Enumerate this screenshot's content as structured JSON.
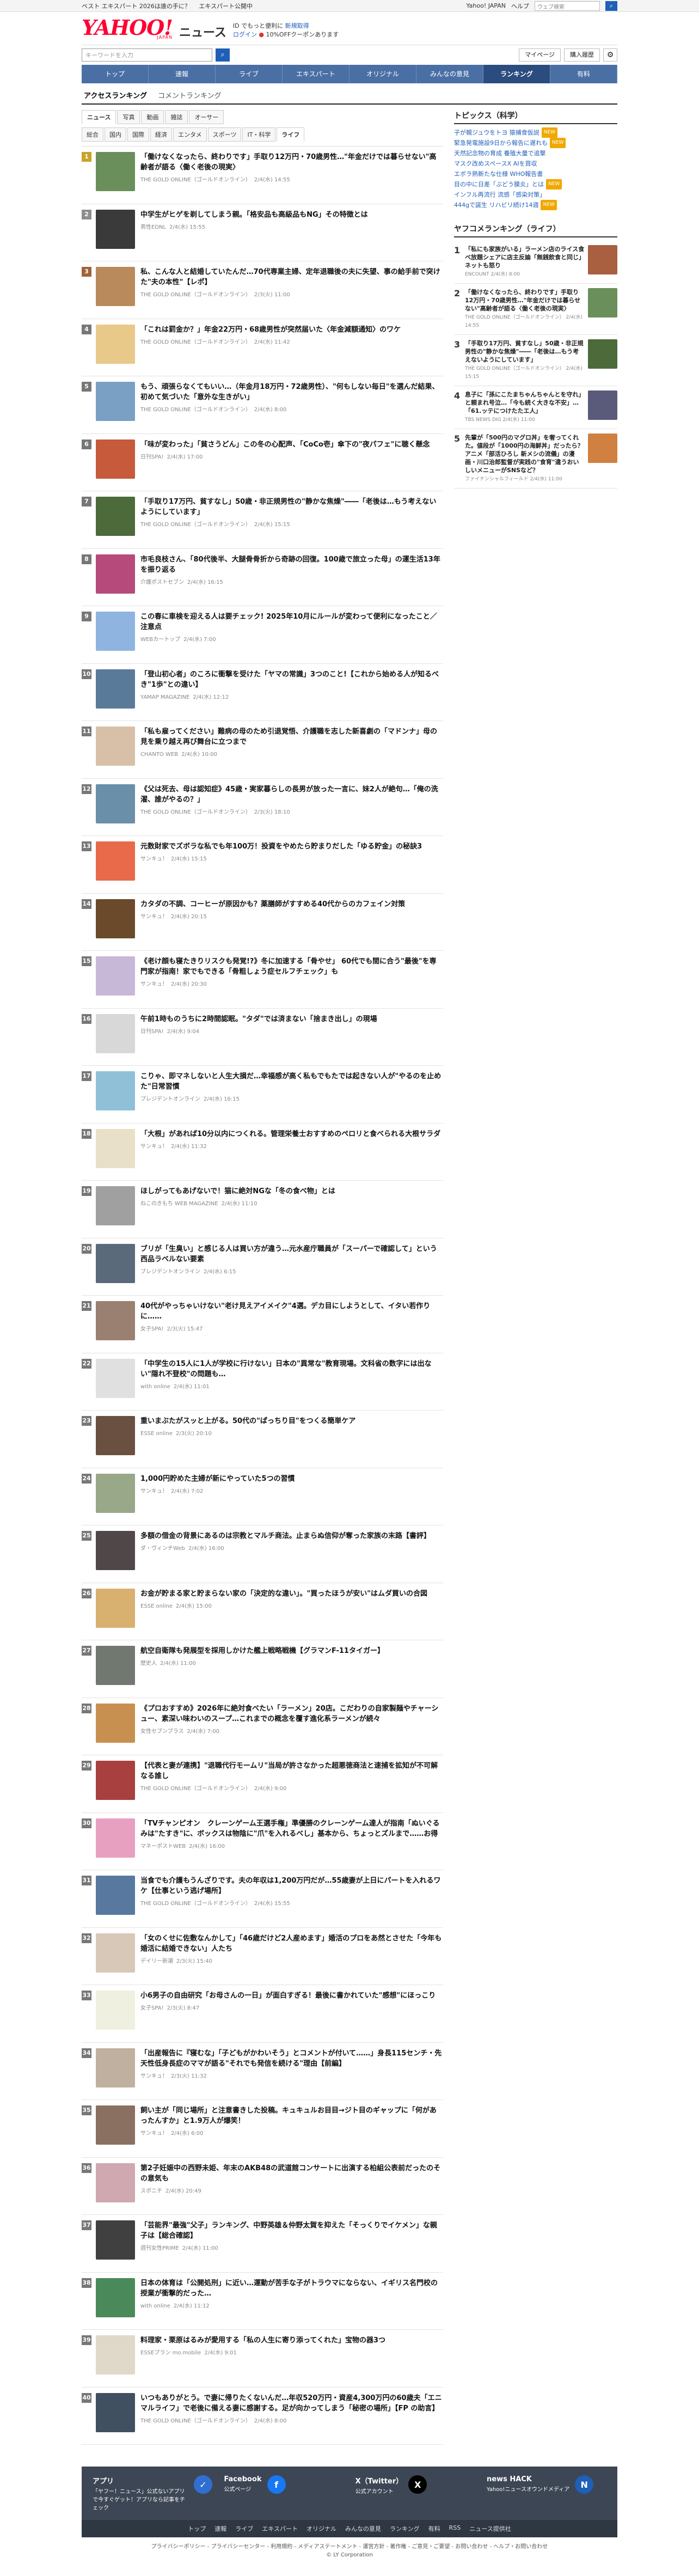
{
  "promo_bar": {
    "left1": "ベスト エキスパート 2026は誰の手に？",
    "left2": "エキスパート公開中",
    "right_links": [
      "Yahoo! JAPAN",
      "ヘルプ"
    ],
    "search_placeholder": "ウェブ検索"
  },
  "masthead": {
    "logo": "YAHOO!",
    "logo_sub": "JAPAN",
    "service": "ニュース",
    "info1_a": "ID でもっと便利に",
    "info1_b": "新規取得",
    "info2_a": "ログイン",
    "info2_b": "10%OFFクーポンあります"
  },
  "search": {
    "placeholder": "キーワードを入力",
    "mypage": "マイページ",
    "subscribe": "購入履歴"
  },
  "gnav": [
    "トップ",
    "速報",
    "ライブ",
    "エキスパート",
    "オリジナル",
    "みんなの意見",
    "ランキング",
    "有料"
  ],
  "gnav_active": 6,
  "subnav": [
    "アクセスランキング",
    "コメントランキング"
  ],
  "media_tabs": [
    "ニュース",
    "写真",
    "動画",
    "雑誌",
    "オーサー"
  ],
  "category_tabs": [
    "総合",
    "国内",
    "国際",
    "経済",
    "エンタメ",
    "スポーツ",
    "IT・科学",
    "ライフ"
  ],
  "rankings": [
    {
      "rank": "1",
      "title": "「働けなくなったら、終わりです」手取り12万円・70歳男性…\"年金だけでは暮らせない\"高齢者が語る〈働く老後の現実〉",
      "source": "THE GOLD ONLINE（ゴールドオンライン）",
      "time": "2/4(水) 14:55",
      "thumb": "#6b8f5a"
    },
    {
      "rank": "2",
      "title": "中学生がヒゲを剃してしまう親。「格安品も高級品もNG」その特徴とは",
      "source": "男性EDNL",
      "time": "2/4(水) 15:55",
      "thumb": "#3a3a3a"
    },
    {
      "rank": "3",
      "title": "私、こんな人と結婚していたんだ…70代専業主婦、定年退職後の夫に失望、事の給手前で突けた\"夫の本性\"【レポ】",
      "source": "THE GOLD ONLINE（ゴールドオンライン）",
      "time": "2/3(火) 11:00",
      "thumb": "#b88a5c"
    },
    {
      "rank": "4",
      "title": "「これは罰金か？」年金22万円・68歳男性が突然届いた〈年金減額通知〉のワケ",
      "source": "THE GOLD ONLINE（ゴールドオンライン）",
      "time": "2/4(水) 11:42",
      "thumb": "#e8c98a"
    },
    {
      "rank": "5",
      "title": "もう、頑張らなくてもいい…（年金月18万円・72歳男性）、\"何もしない毎日\"を選んだ結果、初めて気づいた「意外な生きがい」",
      "source": "THE GOLD ONLINE（ゴールドオンライン）",
      "time": "2/4(水) 8:00",
      "thumb": "#7aa0c4"
    },
    {
      "rank": "6",
      "title": "「味が変わった」「貧さうどん」この冬の心配声、「CoCo壱」傘下の\"夜パフェ\"に聴く懸念",
      "source": "日刊SPA!",
      "time": "2/4(水) 17:00",
      "thumb": "#c65a3a"
    },
    {
      "rank": "7",
      "title": "「手取り17万円、貧すなし」50歳・非正規男性の\"静かな焦燥\"――「老後は…もう考えないようにしています」",
      "source": "THE GOLD ONLINE（ゴールドオンライン）",
      "time": "2/4(水) 15:15",
      "thumb": "#4d6a3a"
    },
    {
      "rank": "8",
      "title": "市毛良枝さん、「80代後半、大腿骨骨折から奇跡の回復。100歳で旅立った母」の運生活13年を振り返る",
      "source": "介護ポストセブン",
      "time": "2/4(水) 16:15",
      "thumb": "#b64a7a"
    },
    {
      "rank": "9",
      "title": "この春に車検を迎える人は要チェック! 2025年10月にルールが変わって便利になったこと／注意点",
      "source": "WEBカートップ",
      "time": "2/4(水) 7:00",
      "thumb": "#8fb4e0"
    },
    {
      "rank": "10",
      "title": "「登山初心者」のころに衝撃を受けた「ヤマの常識」3つのこと!【これから始める人が知るべき\"1歩\"との違い】",
      "source": "YAMAP MAGAZINE",
      "time": "2/4(水) 12:12",
      "thumb": "#5a7a9a"
    },
    {
      "rank": "11",
      "title": "「私も雇ってください」難病の母のため引退覚悟、介護職を志した新喜劇の「マドンナ」母の見を乗り越え再び舞台に立つまで",
      "source": "CHANTO WEB",
      "time": "2/4(水) 10:00",
      "thumb": "#d8c0a8"
    },
    {
      "rank": "12",
      "title": "《父は死去、母は認知症》45歳・実家暮らしの長男が放った一言に、妹2人が絶句…「俺の洗濯、誰がやるの？」",
      "source": "THE GOLD ONLINE（ゴールドオンライン）",
      "time": "2/3(火) 18:10",
      "thumb": "#6a8fa8"
    },
    {
      "rank": "13",
      "title": "元数財家でズボラな私でも年100万！投資をやめたら貯まりだした「ゆる貯金」の秘訣3",
      "source": "サンキュ！",
      "time": "2/4(水) 15:15",
      "thumb": "#e86a4a"
    },
    {
      "rank": "14",
      "title": "カタダの不調、コーヒーが原因かも？薬膳師がすすめる40代からのカフェイン対策",
      "source": "サンキュ！",
      "time": "2/4(水) 20:15",
      "thumb": "#6a4a2a"
    },
    {
      "rank": "15",
      "title": "《老け顔も寝たきりリスクも発覚!?》冬に加速する「骨やせ」 60代でも間に合う\"最後\"を専門家が指南！家でもできる「骨粗しょう症セルフチェック」も",
      "source": "サンキュ！",
      "time": "2/4(水) 20:30",
      "thumb": "#c8b8d8"
    },
    {
      "rank": "16",
      "title": "午前1時ものうちに2時間認眠。\"タダ\"では済まない「捨まき出し」の現場",
      "source": "日刊SPA!",
      "time": "2/4(水) 9:04",
      "thumb": "#d8d8d8"
    },
    {
      "rank": "17",
      "title": "こりゃ、即マネしないと人生大損だ…幸福感が高く私もでもたでは起きない人が\"やるのを止めた\"日常習慣",
      "source": "プレジデントオンライン",
      "time": "2/4(水) 16:15",
      "thumb": "#8fc0d8"
    },
    {
      "rank": "18",
      "title": "「大根」があれば10分以内につくれる。管理栄養士おすすめのペロリと食べられる大根サラダ",
      "source": "サンキュ！",
      "time": "2/4(水) 11:32",
      "thumb": "#e8e0c8"
    },
    {
      "rank": "19",
      "title": "ほしがってもあげないで！猫に絶対NGな「冬の食べ物」とは",
      "source": "ねこのきもち WEB MAGAZINE",
      "time": "2/4(水) 11:10",
      "thumb": "#a0a0a0"
    },
    {
      "rank": "20",
      "title": "ブリが「生臭い」と感じる人は買い方が違う…元水産庁職員が「スーパーで確認して」という西品ラベルない要素",
      "source": "プレジデントオンライン",
      "time": "2/4(水) 6:15",
      "thumb": "#5a6a7a"
    },
    {
      "rank": "21",
      "title": "40代がやっちゃいけない\"老け見えアイメイク\"4選。デカ目にしようとして、イタい若作りに……",
      "source": "女子SPA!",
      "time": "2/3(火) 15:47",
      "thumb": "#9a8070"
    },
    {
      "rank": "22",
      "title": "「中学生の15人に1人が学校に行けない」日本の\"異常な\"教育現場。文科省の数字には出ない\"隠れ不登校\"の問題も…",
      "source": "with online",
      "time": "2/4(水) 11:01",
      "thumb": "#e0e0e0"
    },
    {
      "rank": "23",
      "title": "重いまぶたがスッと上がる。50代の\"ぱっちり目\"をつくる簡単ケア",
      "source": "ESSE online",
      "time": "2/3(火) 20:10",
      "thumb": "#6a5040"
    },
    {
      "rank": "24",
      "title": "1,000円貯めた主婦が新にやっていた5つの習慣",
      "source": "サンキュ！",
      "time": "2/4(水) 7:02",
      "thumb": "#98a888"
    },
    {
      "rank": "25",
      "title": "多額の借金の背景にあるのは宗教とマルチ商法。止まらぬ信仰が奪った家族の末路【書評】",
      "source": "ダ・ヴィンチWeb",
      "time": "2/4(水) 16:00",
      "thumb": "#504848"
    },
    {
      "rank": "26",
      "title": "お金が貯まる家と貯まらない家の「決定的な違い」。\"買ったほうが安い\"はムダ買いの合図",
      "source": "ESSE online",
      "time": "2/4(水) 15:00",
      "thumb": "#d8b070"
    },
    {
      "rank": "27",
      "title": "航空自衛隊も発展型を採用しかけた艦上戦略戦機【グラマンF-11タイガー】",
      "source": "歴史人",
      "time": "2/4(水) 11:00",
      "thumb": "#707870"
    },
    {
      "rank": "28",
      "title": "《プロおすすめ》2026年に絶対食べたい「ラーメン」20店。こだわりの自家製麺やチャーシュー、素深い味わいのスープ…これまでの概念を覆す進化系ラーメンが続々",
      "source": "女性セブンプラス",
      "time": "2/4(水) 7:00",
      "thumb": "#c89050"
    },
    {
      "rank": "29",
      "title": "【代表と妻が連携】\"退職代行モームリ\"当局が許さなかった超悪徳商法と速捕を拡知が不可解なる誰し",
      "source": "THE GOLD ONLINE（ゴールドオンライン）",
      "time": "2/4(水) 9:00",
      "thumb": "#a84040"
    },
    {
      "rank": "30",
      "title": "「TVチャンピオン　クレーンゲーム王選手権」準優勝のクレーンゲーム達人が指南「ぬいぐるみは\"たすき\"に、ボックスは物陰に\"爪\"を入れるべし」基本から、ちょっとズルまで……お得な必勝法とは",
      "source": "マネーポストWEB",
      "time": "2/4(水) 16:00",
      "thumb": "#e8a0c0"
    },
    {
      "rank": "31",
      "title": "当食でも介護もうんざりです。夫の年収は1,200万円だが…55歳妻が上日にパートを入れるワケ【仕事という逃げ場所】",
      "source": "THE GOLD ONLINE（ゴールドオンライン）",
      "time": "2/4(水) 15:55",
      "thumb": "#5878a0"
    },
    {
      "rank": "32",
      "title": "「女のくせに佐敷なんかして」「46歳だけど2人産めます」婚活のプロをあ然とさせた「今年も婚活に結婚できない」人たち",
      "source": "デイリー新潮",
      "time": "2/3(火) 15:40",
      "thumb": "#d8c8b8"
    },
    {
      "rank": "33",
      "title": "小6男子の自由研究「お母さんの一日」が面白すぎる！最後に書かれていた\"感想\"にほっこり",
      "source": "女子SPA!",
      "time": "2/3(火) 8:47",
      "thumb": "#f0f0e0"
    },
    {
      "rank": "34",
      "title": "「出産報告に『寝むな」「子どもがかわいそう」とコメントが付いて……」身長115センチ・先天性低身長症のママが語る\"それでも発信を続ける\"理由【前編】",
      "source": "サンキュ！",
      "time": "2/3(火) 11:32",
      "thumb": "#c0b0a0"
    },
    {
      "rank": "35",
      "title": "飼い主が「同じ場所」と注意書きした投稿。キュキュルお目目→ジト目のギャップに「何があったんすか」と1.9万人が爆笑！",
      "source": "サンキュ！",
      "time": "2/4(水) 6:00",
      "thumb": "#8a7060"
    },
    {
      "rank": "36",
      "title": "第2子妊娠中の西野未姫、年末のAKB48の武道館コンサートに出演する柏組公表前だったのその意気も",
      "source": "スポニチ",
      "time": "2/4(水) 20:49",
      "thumb": "#d0a8b0"
    },
    {
      "rank": "37",
      "title": "「芸能界\"最強\"父子」ランキング、中野英雄＆仲野太賀を抑えた「そっくりでイケメン」な親子は【総合確認】",
      "source": "週刊女性PRIME",
      "time": "2/4(水) 11:00",
      "thumb": "#404040"
    },
    {
      "rank": "38",
      "title": "日本の体育は「公開処刑」に近い…運動が苦手な子がトラウマにならない、イギリス名門校の授業が衝撃的だった…",
      "source": "with online",
      "time": "2/4(水) 11:12",
      "thumb": "#4a8a5a"
    },
    {
      "rank": "39",
      "title": "料理家・栗原はるみが愛用する「私の人生に寄り添ってくれた」宝物の器3つ",
      "source": "ESSEプラン mo.mobile",
      "time": "2/4(水) 9:01",
      "thumb": "#e0d8c8"
    },
    {
      "rank": "40",
      "title": "いつもありがとう。で妻に帰りたくないんだ…年収520万円・資産4,300万円の60歳夫「エニマルライフ」で老後に備える妻に感謝する。足が向かってしまう「秘密の場所」【FP の助言】",
      "source": "THE GOLD ONLINE（ゴールドオンライン）",
      "time": "2/4(水) 8:00",
      "thumb": "#405060"
    }
  ],
  "sidebar": {
    "topics_title": "トピックス（科学）",
    "topics": [
      {
        "text": "子が親ジュウをトヨ 猿捕食仮説",
        "badge": "NEW"
      },
      {
        "text": "緊急発電施設9日から報告に遅れも",
        "badge": "NEW"
      },
      {
        "text": "天然記念物の育成 養殖大量で追撃",
        "badge": ""
      },
      {
        "text": "マスク改めスペースX AIを買収",
        "badge": ""
      },
      {
        "text": "エボラ熱新たな仕様 WHO報告書",
        "badge": ""
      },
      {
        "text": "目の中に日差「ぶどう膜炎」とは",
        "badge": "NEW"
      },
      {
        "text": "インフル再流行 流感「感染対策」",
        "badge": ""
      },
      {
        "text": "444gで誕生 リハビリ続け14週",
        "badge": "NEW"
      }
    ],
    "ranking_title": "ヤフコメランキング（ライフ）",
    "ranking": [
      {
        "rank": "1",
        "title": "「私にも家族がいる」ラーメン店のライス食べ放題シェアに店主反論「無銭飲食と同じ」ネットも怒り",
        "source": "ENCOUNT",
        "time": "2/4(水) 8:00",
        "thumb": "#a86040"
      },
      {
        "rank": "2",
        "title": "「働けなくなったら、終わりです」手取り12万円・70歳男性…\"年金だけでは暮らせない\"高齢者が語る〈働く老後の現実〉",
        "source": "THE GOLD ONLINE（ゴールドオンライン）",
        "time": "2/4(水) 14:55",
        "thumb": "#6b8f5a"
      },
      {
        "rank": "3",
        "title": "「手取り17万円、貧すなし」50歳・非正規男性の\"静かな焦燥\"――「老後は…もう考えないようにしています」",
        "source": "THE GOLD ONLINE（ゴールドオンライン）",
        "time": "2/4(水) 15:15",
        "thumb": "#4d6a3a"
      },
      {
        "rank": "4",
        "title": "息子に「孫にこたまちゃんちゃんとを守れ」と頼まれ号泣…「今も続く大きな不安」…「61.ッテにつけたたエ人」",
        "source": "TBS NEWS DIG",
        "time": "2/4(水) 11:00",
        "thumb": "#5a5a7a"
      },
      {
        "rank": "5",
        "title": "先輩が「500円のマグロ丼」を奢ってくれた。値段が「1000円の海鮮丼」だったら？ アニメ「部活ひろし 新メシの流儀」の漫画・川口治郎監督が実践の\"食育\"違うおいしいメニューがSNSなど？",
        "source": "ファイナンシャルフィールド",
        "time": "2/4(水) 11:00",
        "thumb": "#d08040"
      }
    ]
  },
  "footer": {
    "app_title": "アプリ",
    "app_text": "「ヤフー！ニュース」公式ないアプリで今すぐゲット！アプリなら記事をチェック",
    "facebook": "Facebook",
    "facebook_text": "公式ページ",
    "x_title": "X（Twitter）",
    "x_text": "公式アカウント",
    "hack_title": "news HACK",
    "hack_text": "Yahoo!ニュースオウンドメディア",
    "links": [
      "トップ",
      "速報",
      "ライブ",
      "エキスパート",
      "オリジナル",
      "みんなの意見",
      "ランキング",
      "有料",
      "RSS",
      "ニュース提供社"
    ],
    "legal": "プライバシーポリシー - プライバシーセンター - 利用規約 - メディアステートメント - 運営方針 - 著作権 - ご意見・ご要望 - お問い合わせ - ヘルプ・お問い合わせ",
    "copyright": "© LY Corporation"
  }
}
